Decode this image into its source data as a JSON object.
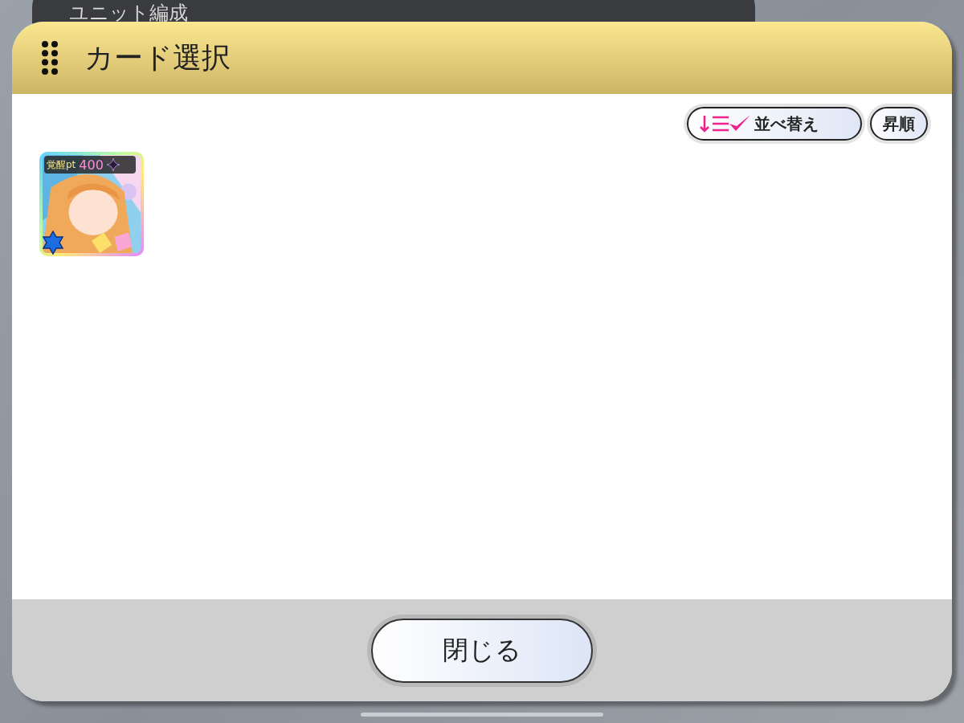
{
  "background": {
    "title": "ユニット編成"
  },
  "dialog": {
    "title": "カード選択",
    "toolbar": {
      "sort_button": "並べ替え",
      "order_button": "昇順"
    },
    "cards": [
      {
        "kind": "picture",
        "label": "覚醒pt",
        "points": "400"
      }
    ],
    "footer": {
      "close_button": "閉じる"
    }
  }
}
